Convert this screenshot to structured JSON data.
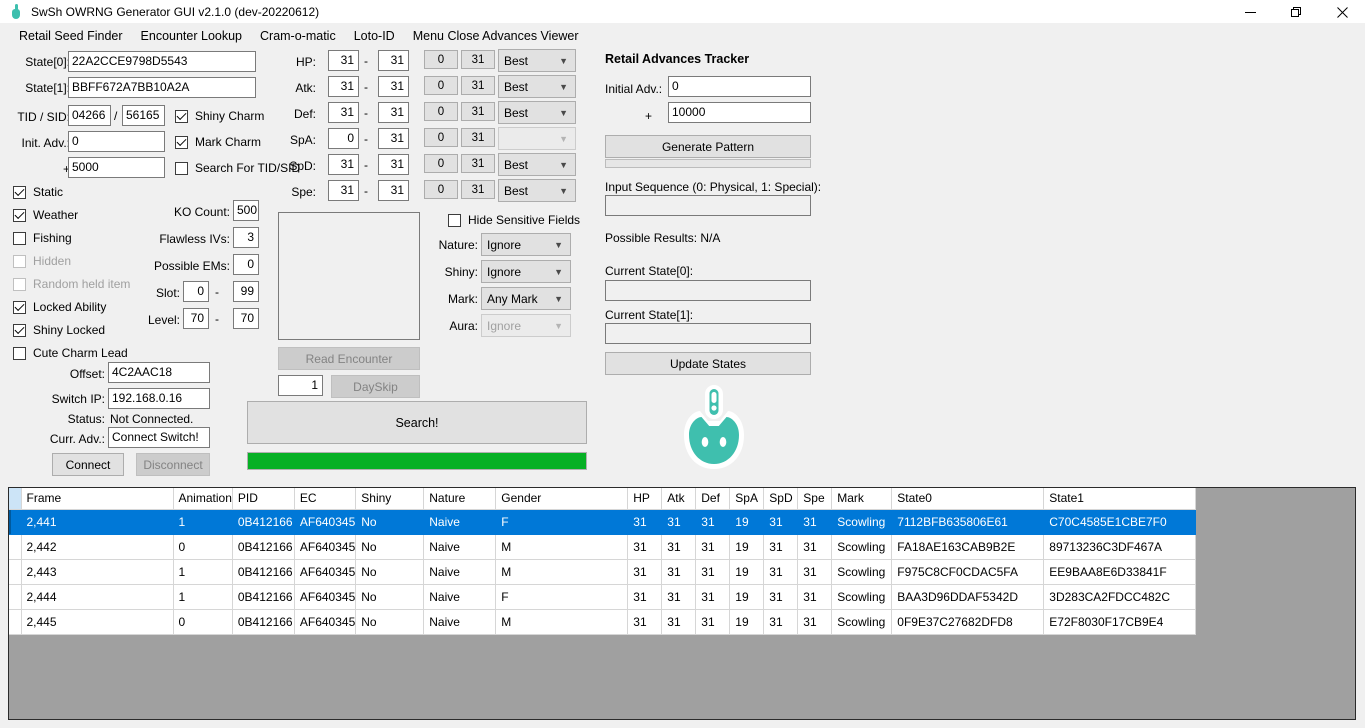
{
  "window": {
    "title": "SwSh OWRNG Generator GUI v2.1.0 (dev-20220612)",
    "icon": "pokeball-sprite-icon",
    "controls": {
      "minimize": "minimize-icon",
      "maximize": "maximize-icon",
      "close": "close-icon"
    }
  },
  "menubar": {
    "items": [
      {
        "label": "Retail Seed Finder"
      },
      {
        "label": "Encounter Lookup"
      },
      {
        "label": "Cram-o-matic"
      },
      {
        "label": "Loto-ID"
      },
      {
        "label": "Menu Close Advances Viewer"
      }
    ]
  },
  "seed_panel": {
    "state0_label": "State[0]:",
    "state0_value": "22A2CCE9798D5543",
    "state1_label": "State[1]:",
    "state1_value": "BBFF672A7BB10A2A",
    "tidsid_label": "TID / SID:",
    "tid_value": "04266",
    "tidsid_sep": "/",
    "sid_value": "56165",
    "init_adv_label": "Init. Adv.:",
    "init_adv_value": "0",
    "plus_label": "+",
    "plus_value": "5000",
    "shiny_charm_label": "Shiny Charm",
    "shiny_charm_checked": true,
    "mark_charm_label": "Mark Charm",
    "mark_charm_checked": true,
    "search_tidsid_label": "Search For TID/SID",
    "search_tidsid_checked": false
  },
  "flags": [
    {
      "label": "Static",
      "checked": true,
      "disabled": false
    },
    {
      "label": "Weather",
      "checked": true,
      "disabled": false
    },
    {
      "label": "Fishing",
      "checked": false,
      "disabled": false
    },
    {
      "label": "Hidden",
      "checked": false,
      "disabled": true
    },
    {
      "label": "Random held item",
      "checked": false,
      "disabled": true
    },
    {
      "label": "Locked Ability",
      "checked": true,
      "disabled": false
    },
    {
      "label": "Shiny Locked",
      "checked": true,
      "disabled": false
    },
    {
      "label": "Cute Charm Lead",
      "checked": false,
      "disabled": false
    }
  ],
  "encounter_params": {
    "ko_count_label": "KO Count:",
    "ko_count_value": "500",
    "flawless_ivs_label": "Flawless IVs:",
    "flawless_ivs_value": "3",
    "possible_ems_label": "Possible EMs:",
    "possible_ems_value": "0",
    "slot_label": "Slot:",
    "slot_min": "0",
    "slot_sep": "-",
    "slot_max": "99",
    "level_label": "Level:",
    "level_min": "70",
    "level_sep": "-",
    "level_max": "70"
  },
  "connection": {
    "offset_label": "Offset:",
    "offset_value": "4C2AAC18",
    "switch_ip_label": "Switch IP:",
    "switch_ip_value": "192.168.0.16",
    "status_label": "Status:",
    "status_value": "Not Connected.",
    "curr_adv_label": "Curr. Adv.:",
    "curr_adv_value": "Connect Switch!",
    "connect_button": "Connect",
    "disconnect_button": "Disconnect"
  },
  "ivs": {
    "sep": "-",
    "rows": [
      {
        "label": "HP:",
        "min": "31",
        "max": "31",
        "btn_min": "0",
        "btn_max": "31",
        "combo": "Best",
        "combo_disabled": false
      },
      {
        "label": "Atk:",
        "min": "31",
        "max": "31",
        "btn_min": "0",
        "btn_max": "31",
        "combo": "Best",
        "combo_disabled": false
      },
      {
        "label": "Def:",
        "min": "31",
        "max": "31",
        "btn_min": "0",
        "btn_max": "31",
        "combo": "Best",
        "combo_disabled": false
      },
      {
        "label": "SpA:",
        "min": "0",
        "max": "31",
        "btn_min": "0",
        "btn_max": "31",
        "combo": "",
        "combo_disabled": true
      },
      {
        "label": "SpD:",
        "min": "31",
        "max": "31",
        "btn_min": "0",
        "btn_max": "31",
        "combo": "Best",
        "combo_disabled": false
      },
      {
        "label": "Spe:",
        "min": "31",
        "max": "31",
        "btn_min": "0",
        "btn_max": "31",
        "combo": "Best",
        "combo_disabled": false
      }
    ]
  },
  "filters": {
    "hide_sensitive_label": "Hide Sensitive Fields",
    "hide_sensitive_checked": false,
    "nature_label": "Nature:",
    "nature_value": "Ignore",
    "shiny_label": "Shiny:",
    "shiny_value": "Ignore",
    "mark_label": "Mark:",
    "mark_value": "Any Mark",
    "aura_label": "Aura:",
    "aura_value": "Ignore",
    "aura_disabled": true
  },
  "actions": {
    "read_encounter": "Read Encounter",
    "dayskip_count": "1",
    "dayskip": "DaySkip",
    "search": "Search!",
    "progress_color": "#06b025",
    "progress_percent": 100
  },
  "tracker": {
    "heading": "Retail Advances Tracker",
    "initial_adv_label": "Initial Adv.:",
    "initial_adv_value": "0",
    "plus_label": "+",
    "plus_value": "10000",
    "generate_pattern": "Generate Pattern",
    "progress_percent": 0,
    "input_sequence_label": "Input Sequence (0: Physical, 1: Special):",
    "input_sequence_value": "",
    "possible_results": "Possible Results: N/A",
    "current_state0_label": "Current State[0]:",
    "current_state0_value": "",
    "current_state1_label": "Current State[1]:",
    "current_state1_value": "",
    "update_states": "Update States"
  },
  "mascot": {
    "name": "toxel-mascot-icon",
    "color": "#3fbfae"
  },
  "results": {
    "columns": [
      "Frame",
      "Animation",
      "PID",
      "EC",
      "Shiny",
      "Nature",
      "Gender",
      "HP",
      "Atk",
      "Def",
      "SpA",
      "SpD",
      "Spe",
      "Mark",
      "State0",
      "State1"
    ],
    "header_corner": "",
    "rows": [
      {
        "selected": true,
        "cells": [
          "2,441",
          "1",
          "0B412166",
          "AF640345",
          "No",
          "Naive",
          "F",
          "31",
          "31",
          "31",
          "19",
          "31",
          "31",
          "Scowling",
          "7112BFB635806E61",
          "C70C4585E1CBE7F0"
        ]
      },
      {
        "selected": false,
        "cells": [
          "2,442",
          "0",
          "0B412166",
          "AF640345",
          "No",
          "Naive",
          "M",
          "31",
          "31",
          "31",
          "19",
          "31",
          "31",
          "Scowling",
          "FA18AE163CAB9B2E",
          "89713236C3DF467A"
        ]
      },
      {
        "selected": false,
        "cells": [
          "2,443",
          "1",
          "0B412166",
          "AF640345",
          "No",
          "Naive",
          "M",
          "31",
          "31",
          "31",
          "19",
          "31",
          "31",
          "Scowling",
          "F975C8CF0CDAC5FA",
          "EE9BAA8E6D33841F"
        ]
      },
      {
        "selected": false,
        "cells": [
          "2,444",
          "1",
          "0B412166",
          "AF640345",
          "No",
          "Naive",
          "F",
          "31",
          "31",
          "31",
          "19",
          "31",
          "31",
          "Scowling",
          "BAA3D96DDAF5342D",
          "3D283CA2FDCC482C"
        ]
      },
      {
        "selected": false,
        "cells": [
          "2,445",
          "0",
          "0B412166",
          "AF640345",
          "No",
          "Naive",
          "M",
          "31",
          "31",
          "31",
          "19",
          "31",
          "31",
          "Scowling",
          "0F9E37C27682DFD8",
          "E72F8030F17CB9E4"
        ]
      }
    ]
  },
  "colors": {
    "accent_selection": "#0078d7",
    "progress_green": "#06b025",
    "header_corner": "#cce4f7",
    "window_bg": "#f0f0f0",
    "grid_bg": "#a0a0a0"
  }
}
